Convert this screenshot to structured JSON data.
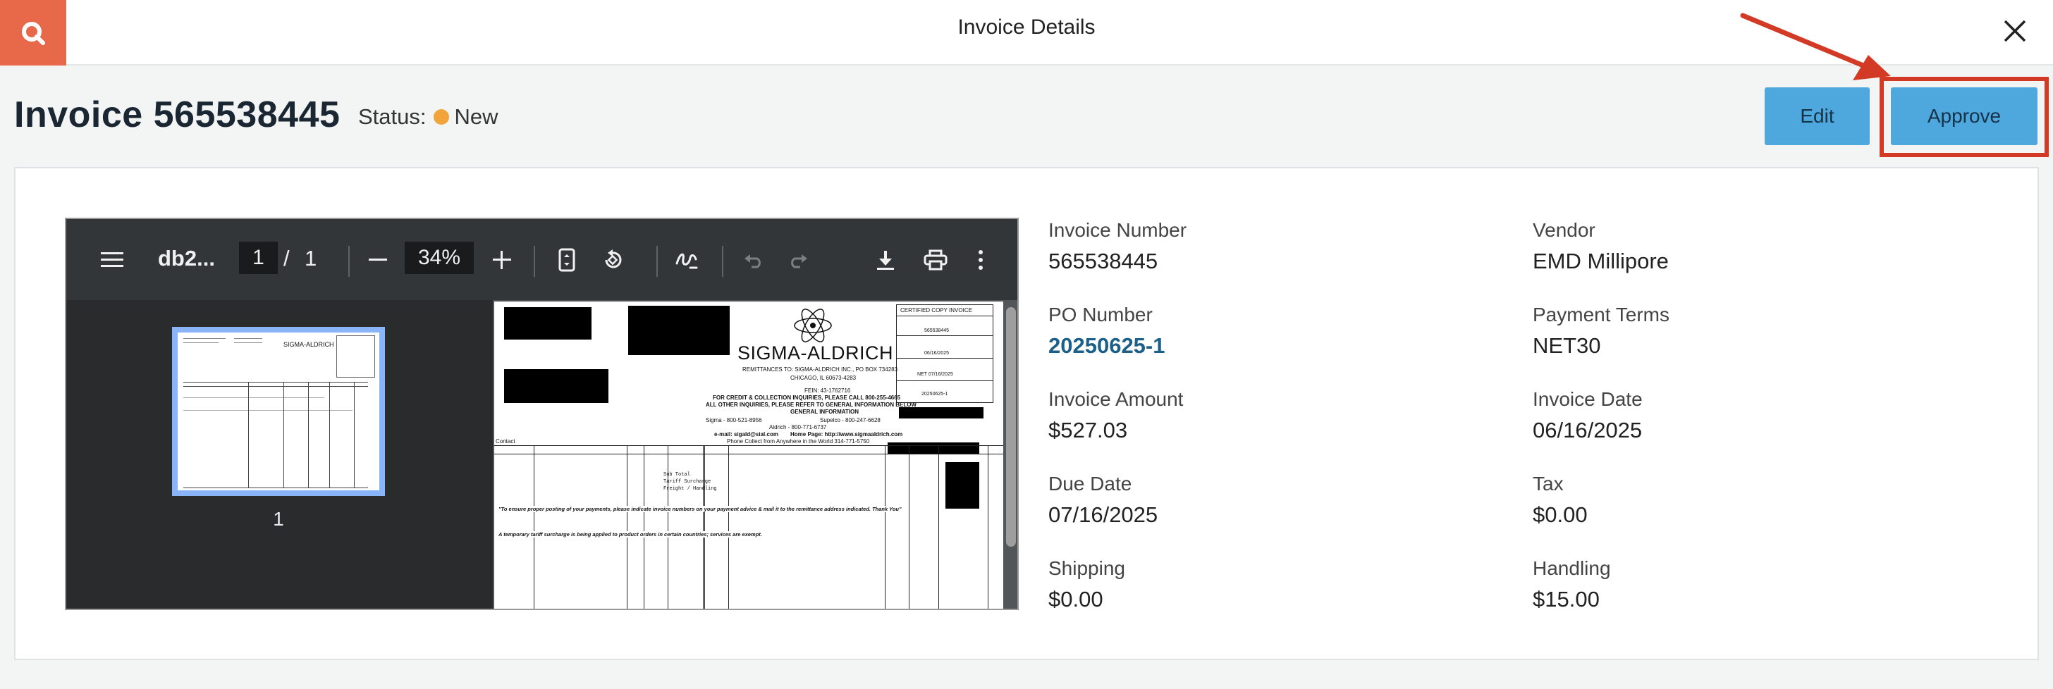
{
  "topbar": {
    "title": "Invoice Details"
  },
  "header": {
    "invoice_title": "Invoice 565538445",
    "status_label": "Status:",
    "status_value": "New",
    "status_color": "#f0a43a",
    "edit_label": "Edit",
    "approve_label": "Approve"
  },
  "viewer": {
    "doc_name": "db2...",
    "page_current": "1",
    "page_separator": "/",
    "page_total": "1",
    "zoom": "34%",
    "thumb_label": "1",
    "document": {
      "brand": "SIGMA-ALDRICH",
      "copy_label": "CERTIFIED COPY INVOICE",
      "remit_line": "REMITTANCES TO: SIGMA-ALDRICH INC., PO BOX 734283",
      "city_line": "CHICAGO, IL 60673-4283",
      "fein_line": "FEIN: 43-1762716",
      "credit_line": "FOR CREDIT & COLLECTION INQUIRIES, PLEASE CALL 800-255-4665",
      "other_line": "ALL OTHER INQUIRIES, PLEASE REFER TO GENERAL INFORMATION BELOW",
      "general_line": "GENERAL INFORMATION",
      "sigma_line": "Sigma - 800-521-8956",
      "aldrich_line": "Aldrich - 800-771-6737",
      "supelco_line": "Supelco - 800-247-6628",
      "email_line": "e-mail: sigald@sial.com",
      "home_line": "Home Page: http://www.sigmaaldrich.com",
      "phone_line": "Phone Collect from Anywhere in the World 314-771-5750",
      "contact_label": "Contact",
      "note_1": "\"To ensure proper posting of your payments, please indicate invoice numbers on your payment advice & mail it to the remittance address indicated. Thank You\"",
      "note_2": "A temporary tariff surcharge is being applied to product orders in certain countries; services are exempt.",
      "subtotal_1": "Sub Total",
      "subtotal_2": "Tariff Surcharge",
      "subtotal_3": "Freight / Handling",
      "inv_no_small": "565538445",
      "inv_date_small": "06/16/2025",
      "due_small": "NET 07/16/2025",
      "po_small": "20250625-1"
    }
  },
  "fields": {
    "invoice_number": {
      "label": "Invoice Number",
      "value": "565538445"
    },
    "vendor": {
      "label": "Vendor",
      "value": "EMD Millipore"
    },
    "po_number": {
      "label": "PO Number",
      "value": "20250625-1"
    },
    "payment_terms": {
      "label": "Payment Terms",
      "value": "NET30"
    },
    "invoice_amount": {
      "label": "Invoice Amount",
      "value": "$527.03"
    },
    "invoice_date": {
      "label": "Invoice Date",
      "value": "06/16/2025"
    },
    "due_date": {
      "label": "Due Date",
      "value": "07/16/2025"
    },
    "tax": {
      "label": "Tax",
      "value": "$0.00"
    },
    "shipping": {
      "label": "Shipping",
      "value": "$0.00"
    },
    "handling": {
      "label": "Handling",
      "value": "$15.00"
    }
  },
  "colors": {
    "brand_orange": "#e8684a",
    "button_blue": "#4ea7dd",
    "highlight_red": "#d33a26",
    "link_blue": "#1c5f88"
  },
  "icons": [
    "search-icon",
    "close-icon",
    "menu-icon",
    "zoom-out-icon",
    "zoom-in-icon",
    "fit-page-icon",
    "rotate-icon",
    "annotate-icon",
    "undo-icon",
    "redo-icon",
    "download-icon",
    "print-icon",
    "more-icon"
  ]
}
